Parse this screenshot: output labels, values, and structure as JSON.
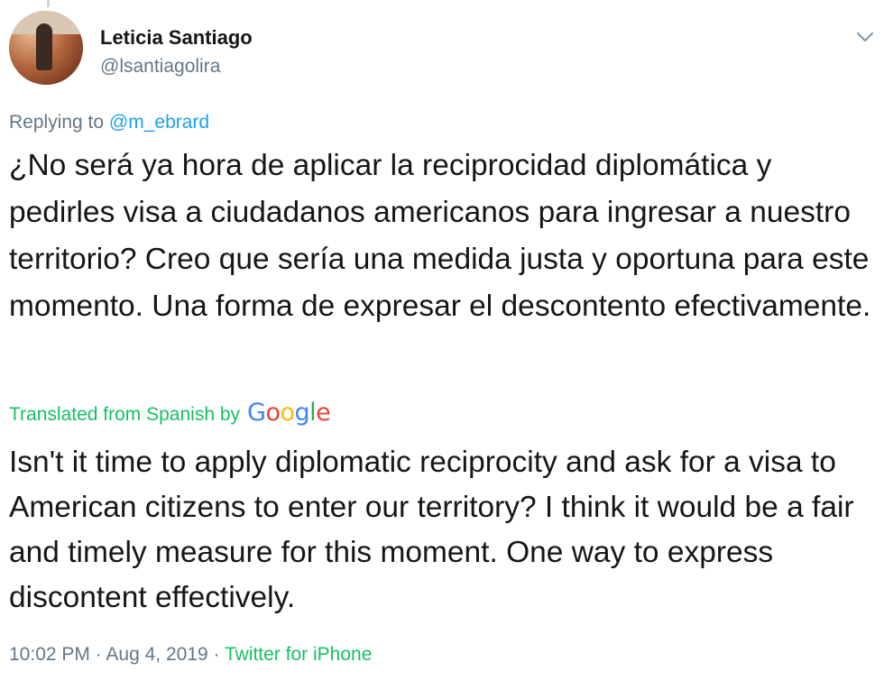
{
  "user": {
    "display_name": "Leticia Santiago",
    "handle": "@lsantiagolira"
  },
  "reply": {
    "prefix": "Replying to ",
    "to_handle": "@m_ebrard"
  },
  "tweet": {
    "text": "¿No será ya hora de aplicar la reciprocidad diplomática y pedirles visa a ciudadanos americanos para ingresar a nuestro territorio? Creo que sería una medida justa y oportuna para este momento. Una forma de expresar el descontento efectivamente."
  },
  "translation": {
    "label": "Translated from Spanish by",
    "provider_letters": [
      "G",
      "o",
      "o",
      "g",
      "l",
      "e"
    ],
    "provider_colors": [
      "#4285f4",
      "#ea4335",
      "#fbbc05",
      "#4285f4",
      "#34a853",
      "#ea4335"
    ],
    "text": "Isn't it time to apply diplomatic reciprocity and ask for a visa to American citizens to enter our territory? I think it would be a fair and timely measure for this moment. One way to express discontent effectively."
  },
  "meta": {
    "time": "10:02 PM",
    "separator": " · ",
    "date": "Aug 4, 2019",
    "source": "Twitter for iPhone"
  },
  "icons": {
    "caret": "chevron-down-icon",
    "avatar": "avatar"
  },
  "colors": {
    "link_blue": "#1da1f2",
    "source_green": "#17bf63",
    "secondary_gray": "#657786",
    "text_dark": "#14171a"
  }
}
